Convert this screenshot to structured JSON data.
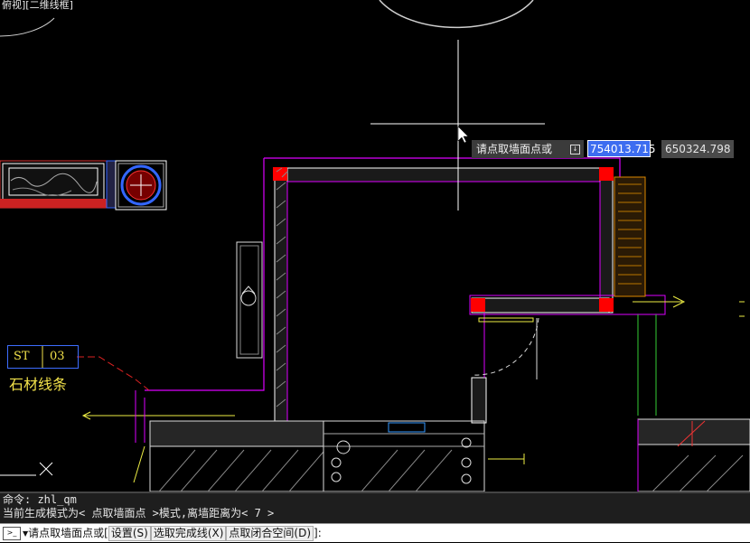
{
  "viewport": {
    "label": "俯视][二维线框]"
  },
  "tooltip": {
    "prompt": "请点取墙面点或",
    "download_glyph": "↓"
  },
  "coords": {
    "x": "754013.715",
    "y": "650324.798"
  },
  "annotation": {
    "code": "ST",
    "number": "03",
    "text": "石材线条"
  },
  "cmd_history": [
    "命令: zhl_qm",
    "当前生成模式为< 点取墙面点 >模式,离墙距离为< 7 >"
  ],
  "cmdline": {
    "prefix": "请点取墙面点或[",
    "options": [
      "设置(S)",
      "选取完成线(X)",
      "点取闭合空间(D)"
    ],
    "sep": " ",
    "suffix": "]:",
    "icon": "command-prompt-icon"
  }
}
